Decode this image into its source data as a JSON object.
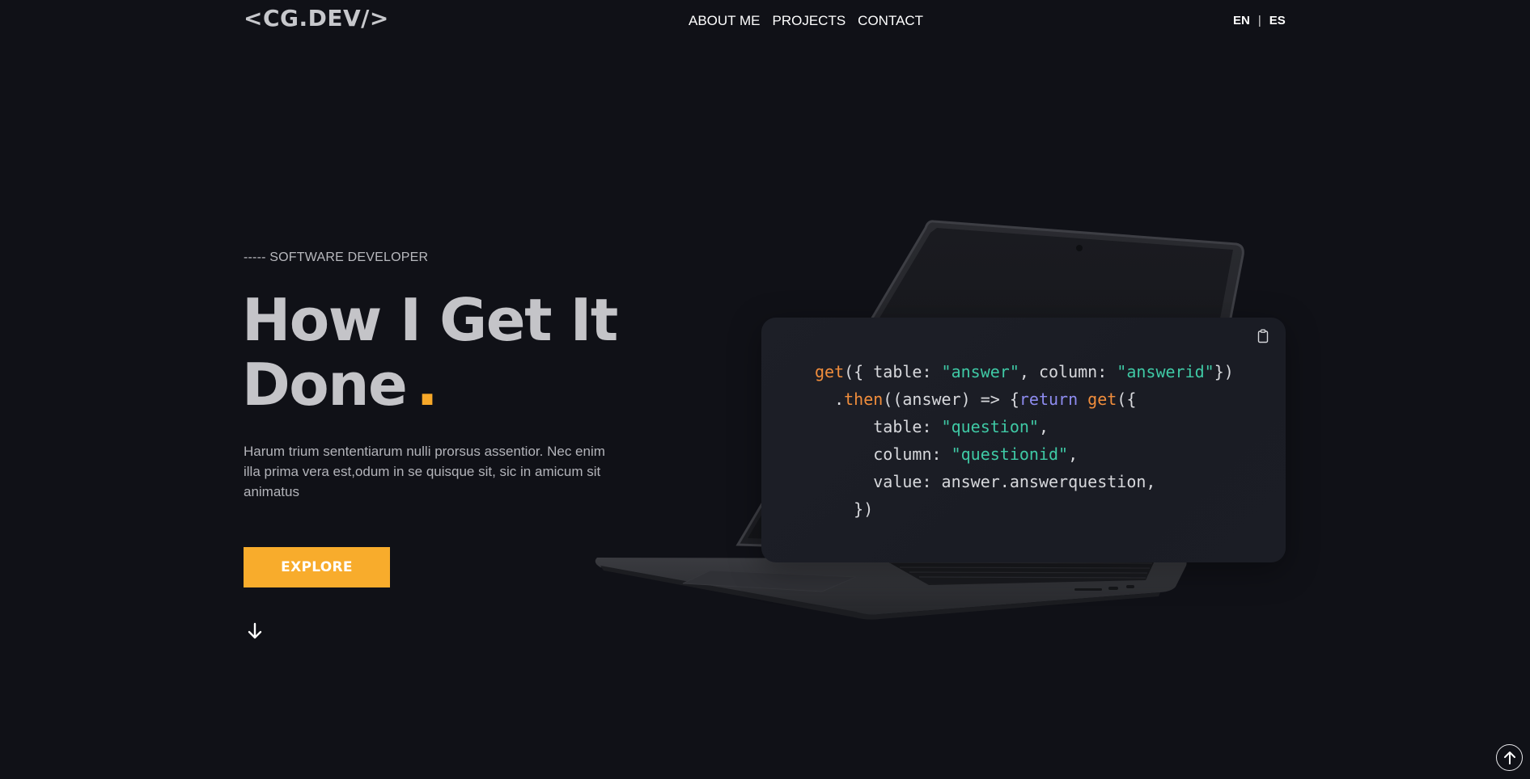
{
  "header": {
    "logo": "<CG.DEV/>",
    "nav": [
      "ABOUT ME",
      "PROJECTS",
      "CONTACT"
    ],
    "languages": [
      "EN",
      "ES"
    ],
    "lang_separator": "|"
  },
  "hero": {
    "tagline": "----- SOFTWARE DEVELOPER",
    "headline_line1": "How I Get It",
    "headline_line2": "Done",
    "headline_dot": ".",
    "description": "Harum trium sententiarum nulli prorsus assentior. Nec enim illa prima vera est,odum in se quisque sit, sic in amicum sit animatus",
    "button_label": "EXPLORE"
  },
  "code_card": {
    "lines": [
      [
        {
          "t": "get",
          "c": "fn"
        },
        {
          "t": "({ table: "
        },
        {
          "t": "\"answer\"",
          "c": "str"
        },
        {
          "t": ", column: "
        },
        {
          "t": "\"answerid\"",
          "c": "str"
        },
        {
          "t": "})"
        }
      ],
      [
        {
          "t": "  ."
        },
        {
          "t": "then",
          "c": "fn"
        },
        {
          "t": "((answer) => {"
        },
        {
          "t": "return",
          "c": "kw"
        },
        {
          "t": " "
        },
        {
          "t": "get",
          "c": "fn"
        },
        {
          "t": "({"
        }
      ],
      [
        {
          "t": "      table: "
        },
        {
          "t": "\"question\"",
          "c": "str"
        },
        {
          "t": ","
        }
      ],
      [
        {
          "t": "      column: "
        },
        {
          "t": "\"questionid\"",
          "c": "str"
        },
        {
          "t": ","
        }
      ],
      [
        {
          "t": "      value: answer.answerquestion,"
        }
      ],
      [
        {
          "t": "    })"
        }
      ]
    ]
  },
  "icons": {
    "copy": "clipboard-icon",
    "scroll_down": "arrow-down-icon",
    "back_to_top": "arrow-up-circle-icon"
  },
  "colors": {
    "background": "#101117",
    "accent": "#f8ac2c",
    "string": "#3fc9a5",
    "function": "#f08d3c",
    "keyword": "#8e8cf0"
  }
}
